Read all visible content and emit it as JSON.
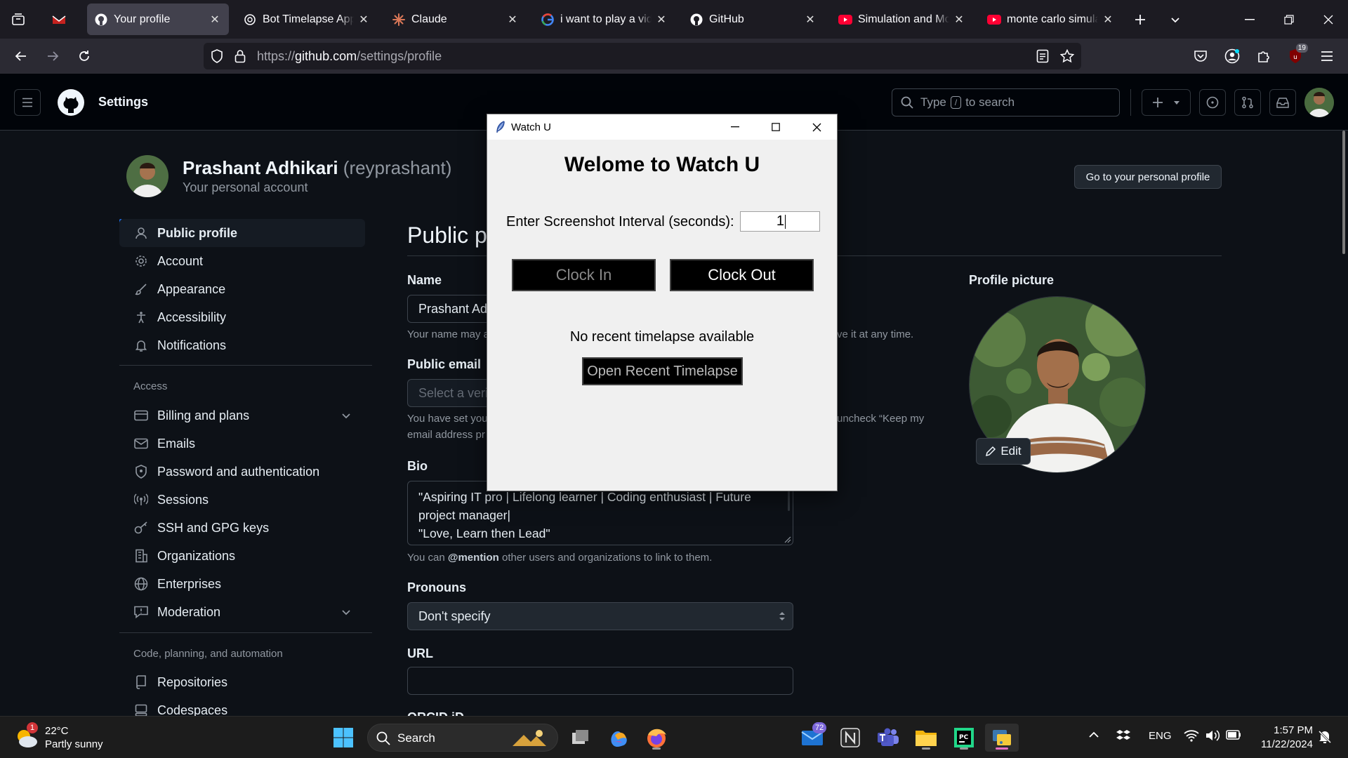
{
  "browser": {
    "tabs": [
      {
        "label": "Your profile",
        "icon": "github-icon",
        "active": true
      },
      {
        "label": "Bot Timelapse App",
        "icon": "openai-icon"
      },
      {
        "label": "Claude",
        "icon": "claude-icon"
      },
      {
        "label": "i want to play a video",
        "icon": "google-icon"
      },
      {
        "label": "GitHub",
        "icon": "github-icon"
      },
      {
        "label": "Simulation and Modeling",
        "icon": "youtube-icon"
      },
      {
        "label": "monte carlo simulation",
        "icon": "youtube-icon"
      }
    ],
    "url_prefix": "https://",
    "url_domain": "github.com",
    "url_path": "/settings/profile",
    "extension_badge": "19"
  },
  "github": {
    "header_title": "Settings",
    "search_prefix": "Type",
    "search_key": "/",
    "search_suffix": "to search",
    "user_name": "Prashant Adhikari",
    "user_handle": "(reyprashant)",
    "account_type": "Your personal account",
    "go_profile_label": "Go to your personal profile",
    "page_title": "Public pr",
    "sidebar": {
      "items_top": [
        {
          "label": "Public profile",
          "icon": "person-icon"
        },
        {
          "label": "Account",
          "icon": "gear-icon"
        },
        {
          "label": "Appearance",
          "icon": "paintbrush-icon"
        },
        {
          "label": "Accessibility",
          "icon": "accessibility-icon"
        },
        {
          "label": "Notifications",
          "icon": "bell-icon"
        }
      ],
      "section_access": "Access",
      "items_access": [
        {
          "label": "Billing and plans",
          "icon": "credit-card-icon"
        },
        {
          "label": "Emails",
          "icon": "mail-icon"
        },
        {
          "label": "Password and authentication",
          "icon": "shield-icon"
        },
        {
          "label": "Sessions",
          "icon": "broadcast-icon"
        },
        {
          "label": "SSH and GPG keys",
          "icon": "key-icon"
        },
        {
          "label": "Organizations",
          "icon": "organization-icon"
        },
        {
          "label": "Enterprises",
          "icon": "globe-icon"
        },
        {
          "label": "Moderation",
          "icon": "report-icon"
        }
      ],
      "section_code": "Code, planning, and automation",
      "items_code": [
        {
          "label": "Repositories",
          "icon": "repo-icon"
        },
        {
          "label": "Codespaces",
          "icon": "codespaces-icon"
        }
      ]
    },
    "form": {
      "name_label": "Name",
      "name_value": "Prashant Adh",
      "name_note_left": "Your name may a",
      "name_note_right": "ve it at any time.",
      "email_label": "Public email",
      "email_placeholder": "Select a verif",
      "email_note_1": "You have set your",
      "email_note_1_right": "uncheck “Keep my",
      "email_note_2": "email address pr",
      "bio_label": "Bio",
      "bio_line_1": "\"Aspiring IT pro | Lifelong learner  | Coding enthusiast | Future",
      "bio_line_2": "project manager|",
      "bio_line_3": "\"Love, Learn then Lead\"",
      "bio_note_pre": "You can",
      "bio_note_mention": "@mention",
      "bio_note_post": "other users and organizations to link to them.",
      "pronouns_label": "Pronouns",
      "pronouns_value": "Don't specify",
      "url_label": "URL",
      "url_value": "",
      "orcid_label": "ORCID iD",
      "profile_picture_label": "Profile picture",
      "edit_label": "Edit"
    }
  },
  "watchu": {
    "window_title": "Watch U",
    "heading": "Welome to Watch U",
    "interval_label": "Enter Screenshot Interval (seconds):",
    "interval_value": "1",
    "clock_in_label": "Clock In",
    "clock_out_label": "Clock Out",
    "status_text": "No recent timelapse available",
    "open_label": "Open Recent Timelapse"
  },
  "taskbar": {
    "weather_temp": "22°C",
    "weather_desc": "Partly sunny",
    "weather_badge": "1",
    "search_label": "Search",
    "mail_badge": "72",
    "lang": "ENG",
    "time": "1:57 PM",
    "date": "11/22/2024"
  }
}
